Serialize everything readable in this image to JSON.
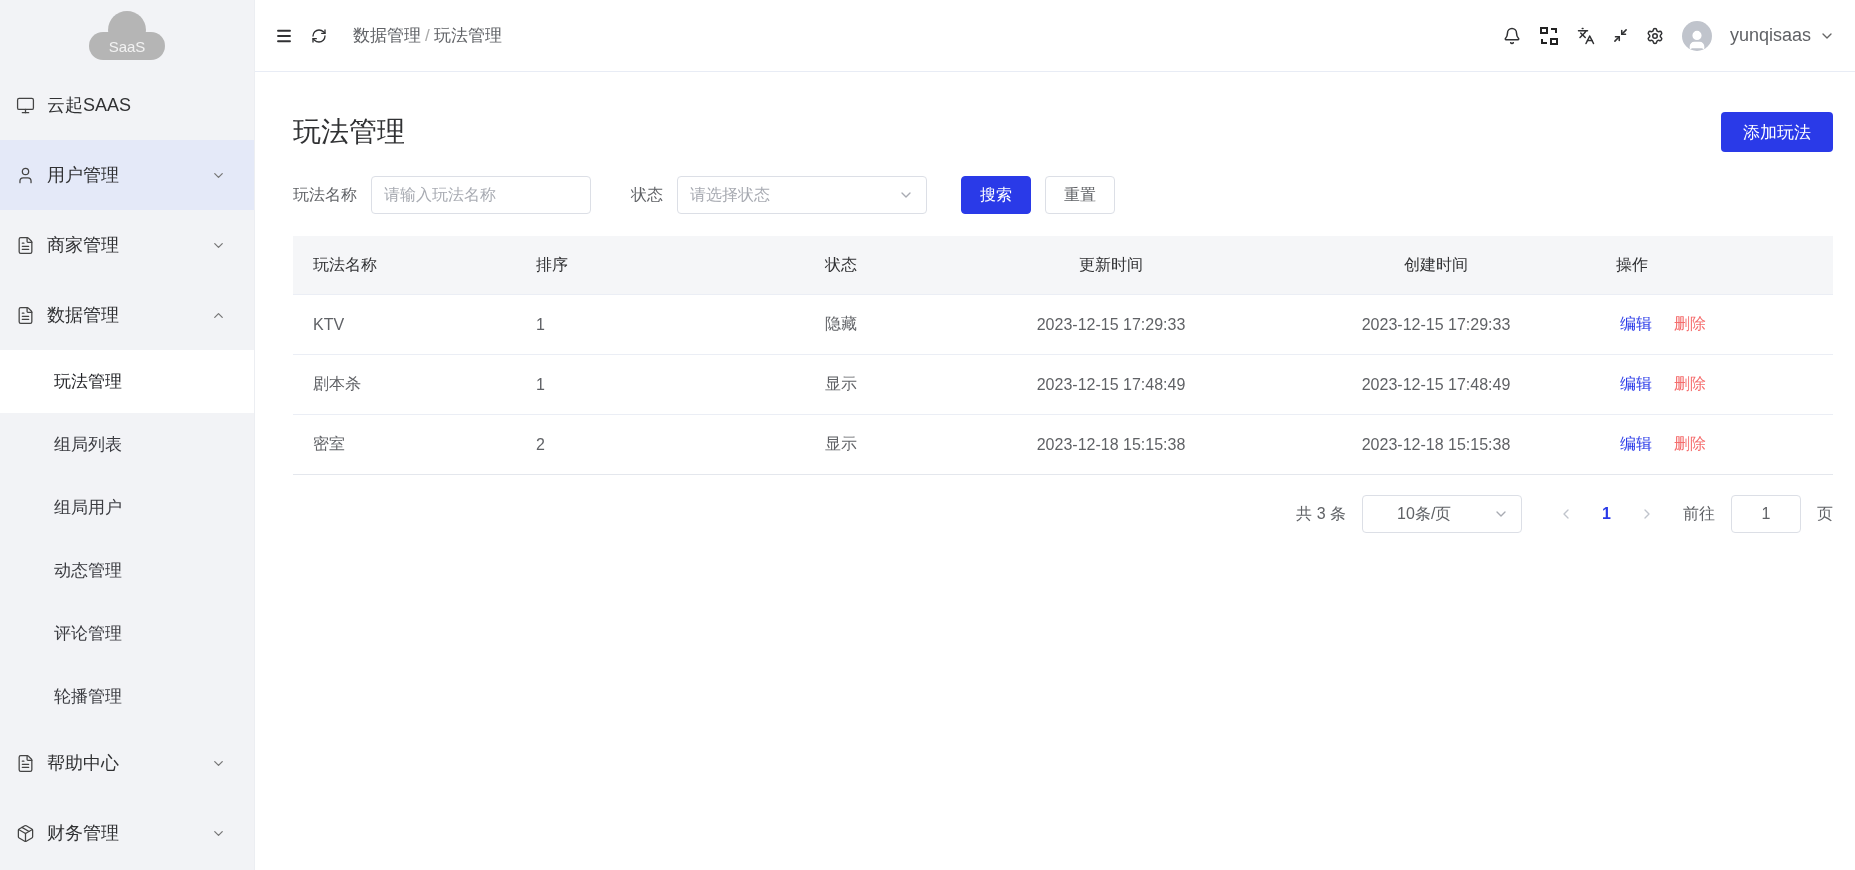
{
  "sidebar": {
    "logo": "SaaS",
    "items": [
      {
        "kind": "link",
        "label": "云起SAAS",
        "hovered": false
      },
      {
        "kind": "group",
        "label": "用户管理",
        "hovered": true,
        "expanded": false
      },
      {
        "kind": "group",
        "label": "商家管理",
        "hovered": false,
        "expanded": false
      },
      {
        "kind": "group",
        "label": "数据管理",
        "hovered": false,
        "expanded": true,
        "children": [
          {
            "label": "玩法管理",
            "selected": true
          },
          {
            "label": "组局列表",
            "selected": false
          },
          {
            "label": "组局用户",
            "selected": false
          },
          {
            "label": "动态管理",
            "selected": false
          },
          {
            "label": "评论管理",
            "selected": false
          },
          {
            "label": "轮播管理",
            "selected": false
          }
        ]
      },
      {
        "kind": "group",
        "label": "帮助中心",
        "hovered": false,
        "expanded": false
      },
      {
        "kind": "group",
        "label": "财务管理",
        "hovered": false,
        "expanded": false
      }
    ]
  },
  "header": {
    "breadcrumb": [
      "数据管理",
      "玩法管理"
    ],
    "separator": "/",
    "user": "yunqisaas"
  },
  "page": {
    "title": "玩法管理",
    "add_button": "添加玩法",
    "filters": [
      {
        "kind": "input",
        "label": "玩法名称",
        "placeholder": "请输入玩法名称"
      },
      {
        "kind": "select",
        "label": "状态",
        "placeholder": "请选择状态"
      }
    ],
    "search_button": "搜索",
    "reset_button": "重置"
  },
  "table": {
    "columns": [
      "玩法名称",
      "排序",
      "状态",
      "更新时间",
      "创建时间",
      "操作"
    ],
    "rows": [
      {
        "cells": [
          "KTV",
          "1",
          "隐藏",
          "2023-12-15 17:29:33",
          "2023-12-15 17:29:33"
        ],
        "actions": [
          {
            "kind": "edit",
            "label": "编辑"
          },
          {
            "kind": "delete",
            "label": "删除"
          }
        ]
      },
      {
        "cells": [
          "剧本杀",
          "1",
          "显示",
          "2023-12-15 17:48:49",
          "2023-12-15 17:48:49"
        ],
        "actions": [
          {
            "kind": "edit",
            "label": "编辑"
          },
          {
            "kind": "delete",
            "label": "删除"
          }
        ]
      },
      {
        "cells": [
          "密室",
          "2",
          "显示",
          "2023-12-18 15:15:38",
          "2023-12-18 15:15:38"
        ],
        "actions": [
          {
            "kind": "edit",
            "label": "编辑"
          },
          {
            "kind": "delete",
            "label": "删除"
          }
        ]
      }
    ]
  },
  "pagination": {
    "total": "共 3 条",
    "page_size": "10条/页",
    "pages": [
      {
        "label": "1",
        "selected": true
      }
    ],
    "goto_label": "前往",
    "goto_value": "1",
    "goto_suffix": "页"
  }
}
